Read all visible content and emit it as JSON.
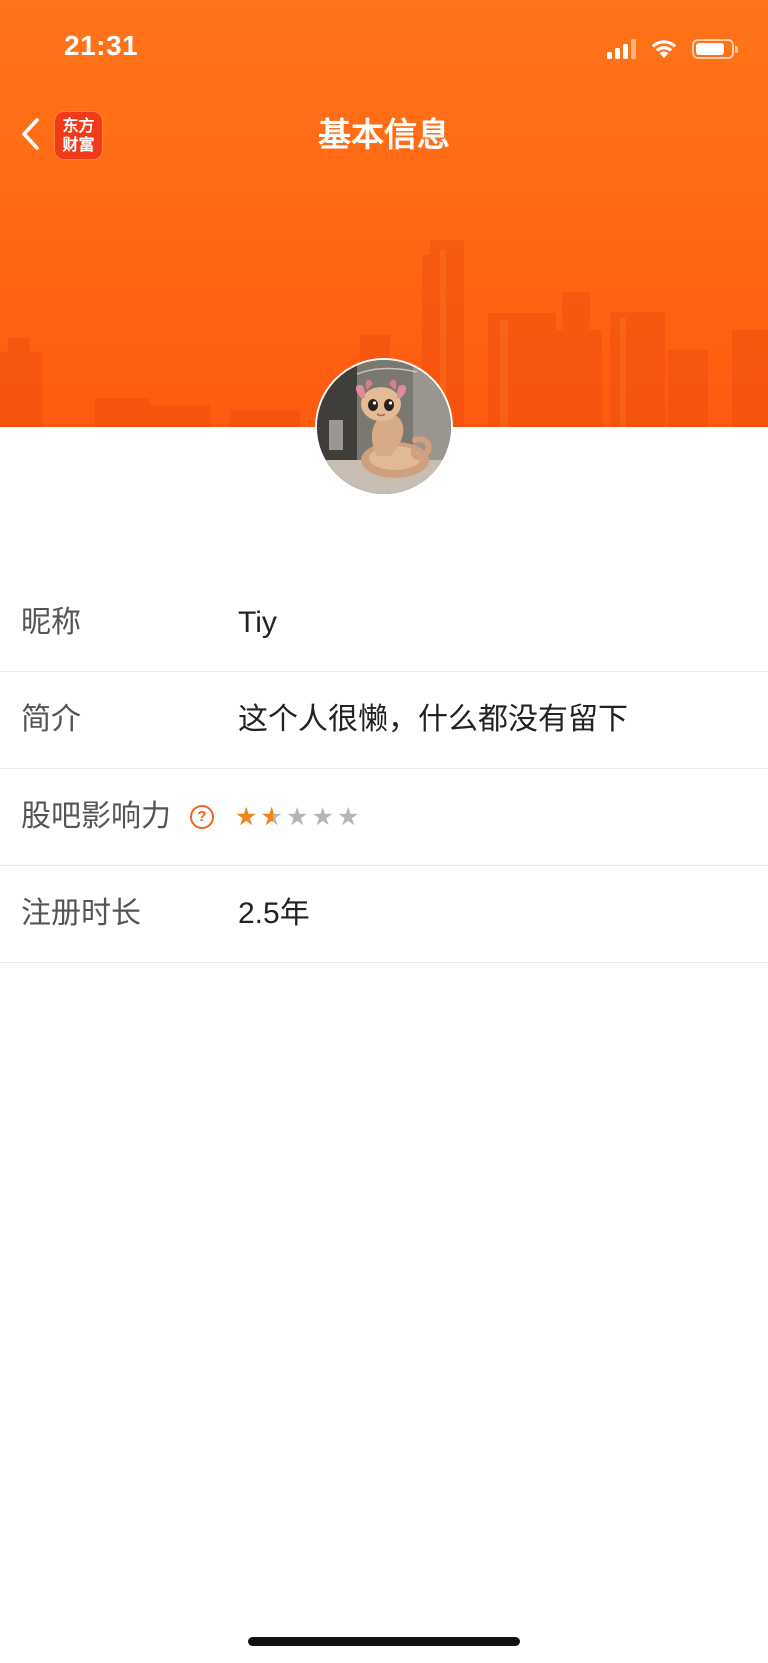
{
  "status_bar": {
    "time": "21:31",
    "battery_level": 0.85,
    "icons": [
      "signal-icon",
      "wifi-icon",
      "battery-icon"
    ]
  },
  "header": {
    "title": "基本信息",
    "back_icon": "chevron-left-icon",
    "logo_line1": "东方",
    "logo_line2": "财富"
  },
  "profile": {
    "rows": [
      {
        "label": "昵称",
        "value": "Tiy"
      },
      {
        "label": "简介",
        "value": "这个人很懒，什么都没有留下"
      },
      {
        "label": "股吧影响力",
        "help_icon": "question-circle-icon",
        "help_glyph": "?",
        "rating": 1.5,
        "rating_max": 5
      },
      {
        "label": "注册时长",
        "value": "2.5年"
      }
    ]
  },
  "colors": {
    "banner": "#ff6a14",
    "logo": "#f03a1a",
    "star_active": "#f4841c",
    "star_inactive": "#b5b5b5",
    "label_text": "#555555",
    "value_text": "#222222"
  }
}
